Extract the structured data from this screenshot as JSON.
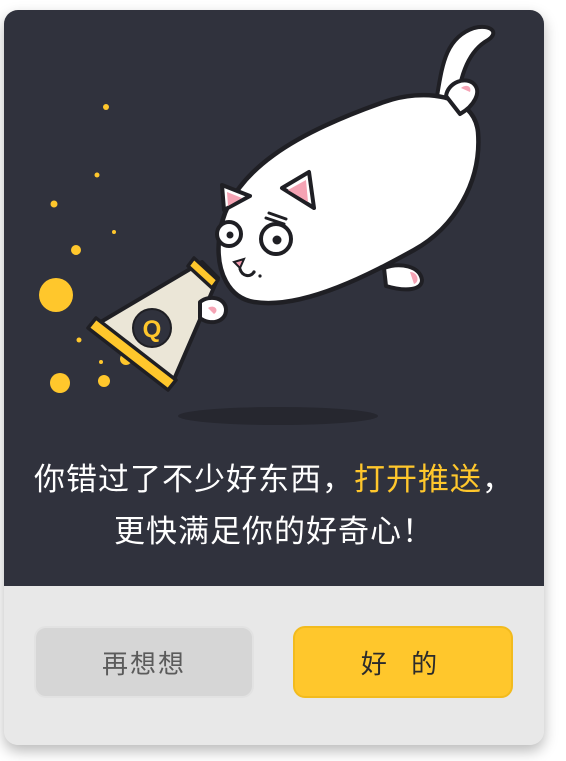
{
  "dialog": {
    "message": {
      "line1_prefix": "你错过了不少好东西，",
      "line1_highlight": "打开推送",
      "line1_suffix": "，",
      "line2": "更快满足你的好奇心！"
    },
    "buttons": {
      "secondary_label": "再想想",
      "primary_label": "好 的"
    },
    "megaphone_logo_letter": "Q"
  },
  "colors": {
    "background_dark": "#30323d",
    "background_light": "#e8e8e8",
    "accent_yellow": "#ffc72c",
    "secondary_button": "#d6d6d6",
    "text_white": "#ffffff"
  },
  "icons": [
    "cat-illustration",
    "megaphone-icon"
  ]
}
